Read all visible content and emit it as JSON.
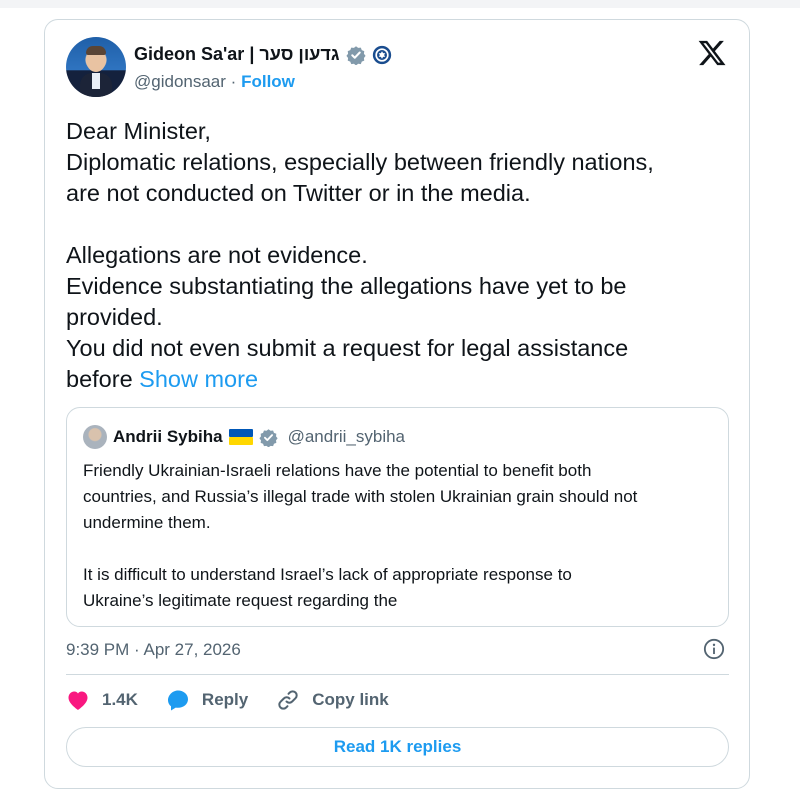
{
  "author": {
    "name": "Gideon Sa'ar | גדעון סער",
    "handle": "@gidonsaar",
    "separator": "·",
    "follow_label": "Follow"
  },
  "tweet": {
    "text": "Dear Minister,\nDiplomatic relations, especially between friendly nations,\nare not conducted on Twitter or in the media.\n\nAllegations are not evidence.\nEvidence substantiating the allegations have yet to be\nprovided.\nYou did not even submit a request for legal assistance\nbefore ",
    "show_more_label": "Show more",
    "timestamp": "9:39 PM · Apr 27, 2026"
  },
  "quoted": {
    "name": "Andrii Sybiha",
    "handle": "@andrii_sybiha",
    "text": "Friendly Ukrainian-Israeli relations have the potential to benefit both\ncountries, and Russia’s illegal trade with stolen Ukrainian grain should not\nundermine them.\n\nIt is difficult to understand Israel’s lack of appropriate response to\nUkraine’s legitimate request regarding the"
  },
  "actions": {
    "like_count": "1.4K",
    "reply_label": "Reply",
    "copy_link_label": "Copy link"
  },
  "read_replies_label": "Read 1K replies",
  "colors": {
    "accent": "#1d9bf0",
    "like": "#f91880",
    "verified": "#829aab",
    "text": "#0f1419",
    "muted": "#536471",
    "border": "#cfd9de"
  },
  "icons": [
    "x-logo-icon",
    "verified-badge-icon",
    "government-emblem-icon",
    "ukraine-flag-icon",
    "info-icon",
    "heart-icon",
    "reply-bubble-icon",
    "link-icon"
  ]
}
